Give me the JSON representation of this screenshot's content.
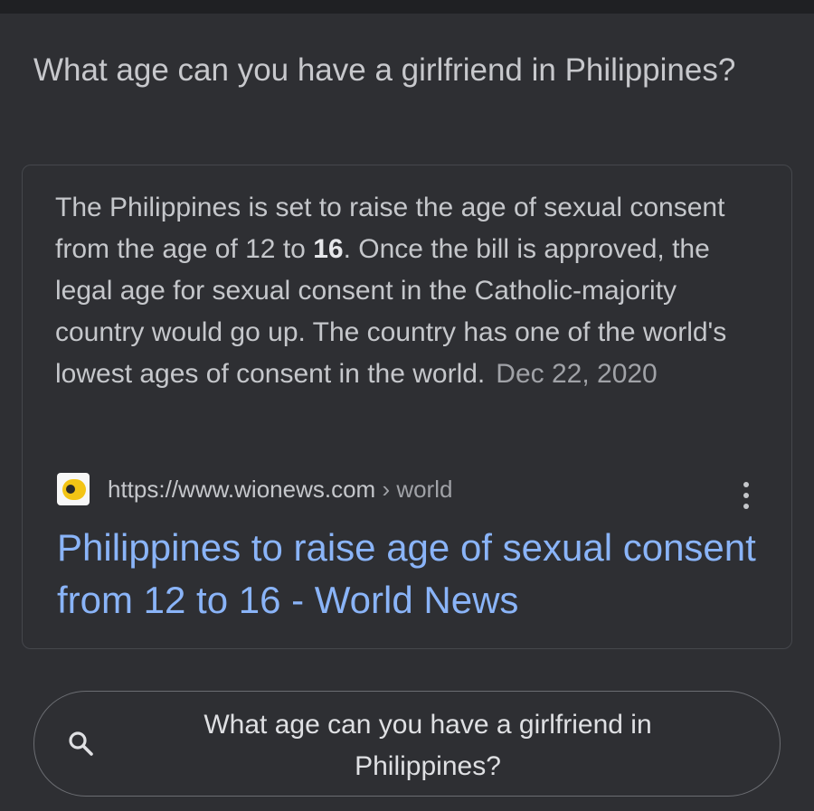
{
  "question": {
    "title": "What age can you have a girlfriend in Philippines?"
  },
  "answer": {
    "text_before": "The Philippines is set to raise the age of sexual consent from the age of 12 to ",
    "highlight": "16",
    "text_after": ". Once the bill is approved, the legal age for sexual consent in the Catholic-majority country would go up. The country has one of the world's lowest ages of consent in the world.",
    "date": "Dec 22, 2020"
  },
  "source": {
    "url": "https://www.wionews.com",
    "path": " › world",
    "favicon_icon": "wionews-favicon-icon",
    "menu_icon": "more-vert-icon"
  },
  "result": {
    "title": "Philippines to raise age of sexual consent from 12 to 16 - World News",
    "link_color": "#8ab4f8"
  },
  "search_bar": {
    "icon": "search-icon",
    "query": "What age can you have a girlfriend in Philippines?"
  }
}
